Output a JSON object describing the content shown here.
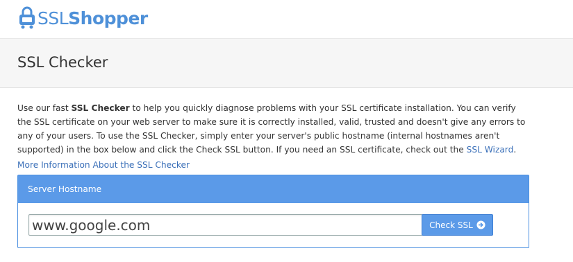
{
  "brand": {
    "part1": "SSL",
    "part2": "Shopper"
  },
  "page": {
    "title": "SSL Checker"
  },
  "intro": {
    "text_before": "Use our fast ",
    "bold": "SSL Checker",
    "text_after": " to help you quickly diagnose problems with your SSL certificate installation. You can verify the SSL certificate on your web server to make sure it is correctly installed, valid, trusted and doesn't give any errors to any of your users. To use the SSL Checker, simply enter your server's public hostname (internal hostnames aren't supported) in the box below and click the Check SSL button. If you need an SSL certificate, check out the ",
    "wizard_link": "SSL Wizard",
    "end": "."
  },
  "more_info_link": "More Information About the SSL Checker",
  "form": {
    "heading": "Server Hostname",
    "hostname_value": "www.google.com",
    "button_label": "Check SSL"
  },
  "colors": {
    "brand_blue": "#4e90d8",
    "panel_blue": "#5b9ae8",
    "link_blue": "#3a6fb8"
  }
}
